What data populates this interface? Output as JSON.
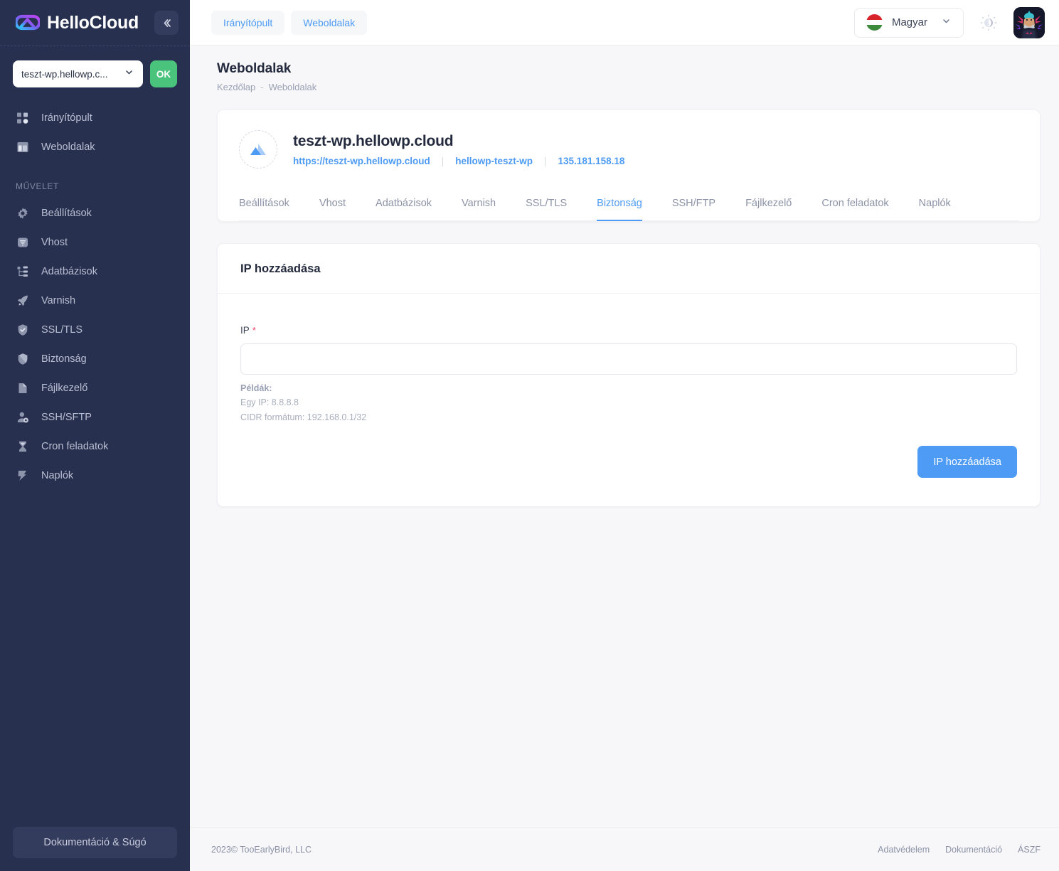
{
  "brand": {
    "name": "HelloCloud",
    "collapse_icon": "chevrons-left-icon"
  },
  "sidebar": {
    "site_selector": {
      "value": "teszt-wp.hellowp.c...",
      "chevron_icon": "chevron-down-icon"
    },
    "ok_label": "OK",
    "nav_primary": [
      {
        "label": "Irányítópult",
        "icon": "dashboard-icon"
      },
      {
        "label": "Weboldalak",
        "icon": "layout-icon"
      }
    ],
    "section_label": "MŰVELET",
    "nav_actions": [
      {
        "label": "Beállítások",
        "icon": "gear-icon"
      },
      {
        "label": "Vhost",
        "icon": "filter-icon"
      },
      {
        "label": "Adatbázisok",
        "icon": "database-tree-icon"
      },
      {
        "label": "Varnish",
        "icon": "rocket-icon"
      },
      {
        "label": "SSL/TLS",
        "icon": "shield-check-icon"
      },
      {
        "label": "Biztonság",
        "icon": "shield-icon"
      },
      {
        "label": "Fájlkezelő",
        "icon": "file-icon"
      },
      {
        "label": "SSH/SFTP",
        "icon": "user-key-icon"
      },
      {
        "label": "Cron feladatok",
        "icon": "hourglass-icon"
      },
      {
        "label": "Naplók",
        "icon": "logs-icon"
      }
    ],
    "docs_button": "Dokumentáció & Súgó"
  },
  "topbar": {
    "crumb_tabs": [
      {
        "label": "Irányítópult"
      },
      {
        "label": "Weboldalak"
      }
    ],
    "language": {
      "value": "Magyar",
      "flag_icon": "flag-hungary-icon",
      "chevron_icon": "chevron-down-icon"
    },
    "theme_toggle_icon": "sun-moon-icon",
    "avatar_icon": "user-avatar"
  },
  "page": {
    "title": "Weboldalak",
    "breadcrumb": {
      "home": "Kezdőlap",
      "separator": "-",
      "current": "Weboldalak"
    }
  },
  "site": {
    "icon": "mountain-site-icon",
    "name": "teszt-wp.hellowp.cloud",
    "url": "https://teszt-wp.hellowp.cloud",
    "slug": "hellowp-teszt-wp",
    "ip": "135.181.158.18",
    "separator": "|"
  },
  "tabs": [
    {
      "label": "Beállítások",
      "active": false
    },
    {
      "label": "Vhost",
      "active": false
    },
    {
      "label": "Adatbázisok",
      "active": false
    },
    {
      "label": "Varnish",
      "active": false
    },
    {
      "label": "SSL/TLS",
      "active": false
    },
    {
      "label": "Biztonság",
      "active": true
    },
    {
      "label": "SSH/FTP",
      "active": false
    },
    {
      "label": "Fájlkezelő",
      "active": false
    },
    {
      "label": "Cron feladatok",
      "active": false
    },
    {
      "label": "Naplók",
      "active": false
    }
  ],
  "form": {
    "card_title": "IP hozzáadása",
    "ip_label": "IP",
    "required_mark": "*",
    "ip_value": "",
    "ip_placeholder": "",
    "hints_title": "Példák:",
    "hint_single": "Egy IP: 8.8.8.8",
    "hint_cidr": "CIDR formátum: 192.168.0.1/32",
    "submit_label": "IP hozzáadása"
  },
  "footer": {
    "copyright": "2023©  TooEarlyBird, LLC",
    "links": [
      {
        "label": "Adatvédelem"
      },
      {
        "label": "Dokumentáció"
      },
      {
        "label": "ÁSZF"
      }
    ]
  },
  "colors": {
    "sidebar_bg": "#28304f",
    "accent_blue": "#4d9bf5",
    "ok_green": "#4ac47c",
    "required_red": "#f0426b",
    "page_bg": "#f7f7f9"
  }
}
